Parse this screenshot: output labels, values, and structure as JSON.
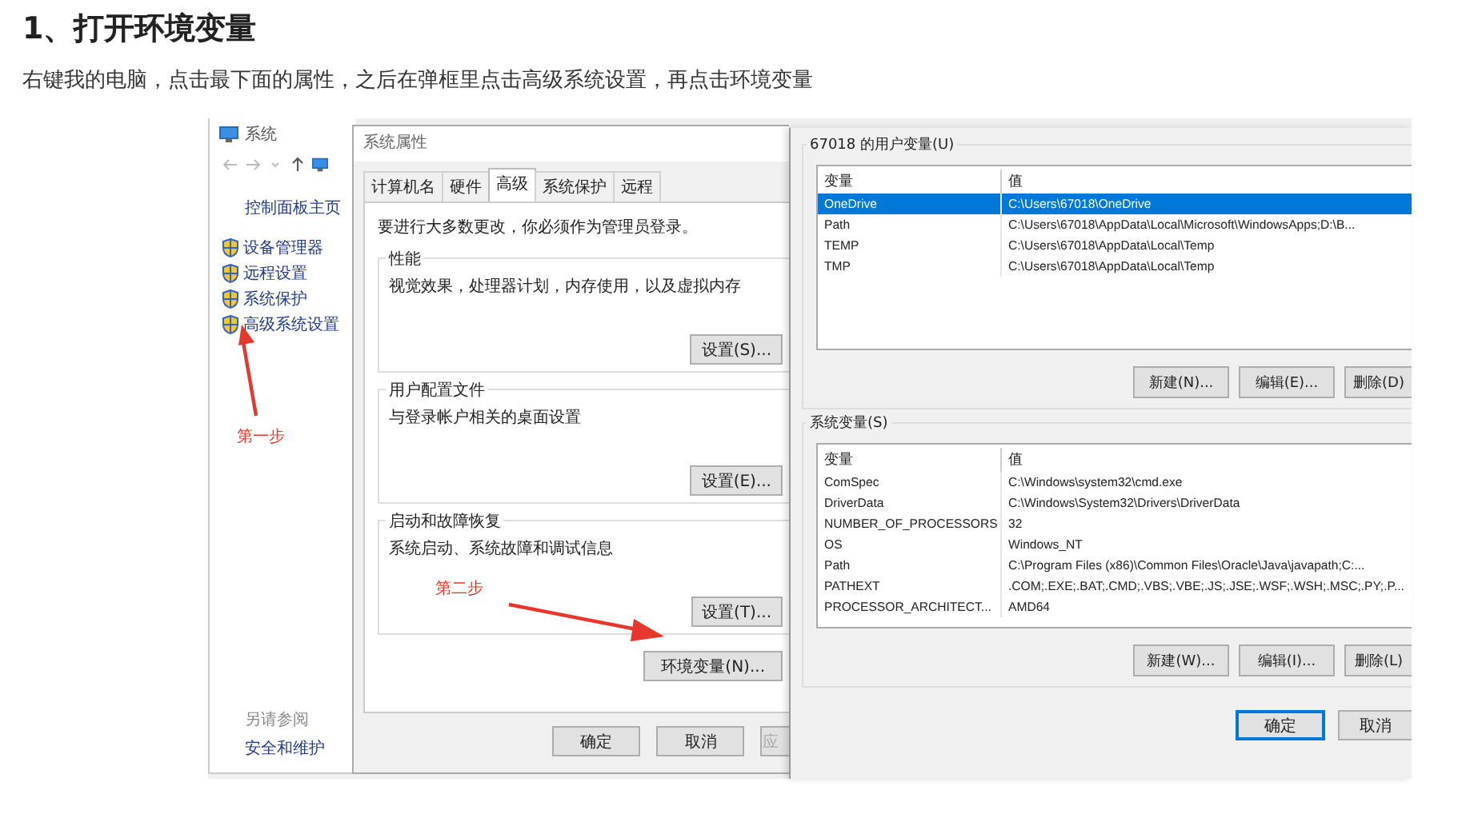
{
  "heading": "1、打开环境变量",
  "intro": "右键我的电脑，点击最下面的属性，之后在弹框里点击高级系统设置，再点击环境变量",
  "screenshot": {
    "system_window": {
      "title": "系统",
      "sidebar_links": [
        {
          "label": "控制面板主页",
          "kind": "plain"
        },
        {
          "label": "设备管理器",
          "kind": "shield"
        },
        {
          "label": "远程设置",
          "kind": "shield"
        },
        {
          "label": "系统保护",
          "kind": "shield"
        },
        {
          "label": "高级系统设置",
          "kind": "shield"
        }
      ],
      "see_also_title": "另请参阅",
      "see_also_links": [
        "安全和维护"
      ]
    },
    "properties_dialog": {
      "title": "系统属性",
      "tabs": [
        {
          "label": "计算机名",
          "selected": false
        },
        {
          "label": "硬件",
          "selected": false
        },
        {
          "label": "高级",
          "selected": true
        },
        {
          "label": "系统保护",
          "selected": false
        },
        {
          "label": "远程",
          "selected": false
        }
      ],
      "notice": "要进行大多数更改，你必须作为管理员登录。",
      "groups": [
        {
          "title": "性能",
          "description": "视觉效果，处理器计划，内存使用，以及虚拟内存",
          "button": "设置(S)..."
        },
        {
          "title": "用户配置文件",
          "description": "与登录帐户相关的桌面设置",
          "button": "设置(E)..."
        },
        {
          "title": "启动和故障恢复",
          "description": "系统启动、系统故障和调试信息",
          "button": "设置(T)..."
        }
      ],
      "env_button": "环境变量(N)...",
      "buttons": [
        {
          "label": "确定",
          "default": false
        },
        {
          "label": "取消",
          "default": false
        },
        {
          "label": "应",
          "default": false
        }
      ]
    },
    "env_dialog": {
      "sections": [
        {
          "title": "67018 的用户变量(U)",
          "columns": [
            "变量",
            "值"
          ],
          "rows": [
            {
              "name": "OneDrive",
              "value": "C:\\Users\\67018\\OneDrive",
              "selected": true
            },
            {
              "name": "Path",
              "value": "C:\\Users\\67018\\AppData\\Local\\Microsoft\\WindowsApps;D:\\B...",
              "selected": false
            },
            {
              "name": "TEMP",
              "value": "C:\\Users\\67018\\AppData\\Local\\Temp",
              "selected": false
            },
            {
              "name": "TMP",
              "value": "C:\\Users\\67018\\AppData\\Local\\Temp",
              "selected": false
            }
          ],
          "buttons": [
            "新建(N)...",
            "编辑(E)...",
            "删除(D)"
          ]
        },
        {
          "title": "系统变量(S)",
          "columns": [
            "变量",
            "值"
          ],
          "rows": [
            {
              "name": "ComSpec",
              "value": "C:\\Windows\\system32\\cmd.exe",
              "selected": false
            },
            {
              "name": "DriverData",
              "value": "C:\\Windows\\System32\\Drivers\\DriverData",
              "selected": false
            },
            {
              "name": "NUMBER_OF_PROCESSORS",
              "value": "32",
              "selected": false
            },
            {
              "name": "OS",
              "value": "Windows_NT",
              "selected": false
            },
            {
              "name": "Path",
              "value": "C:\\Program Files (x86)\\Common Files\\Oracle\\Java\\javapath;C:...",
              "selected": false
            },
            {
              "name": "PATHEXT",
              "value": ".COM;.EXE;.BAT;.CMD;.VBS;.VBE;.JS;.JSE;.WSF;.WSH;.MSC;.PY;.P...",
              "selected": false
            },
            {
              "name": "PROCESSOR_ARCHITECT...",
              "value": "AMD64",
              "selected": false
            }
          ],
          "buttons": [
            "新建(W)...",
            "编辑(I)...",
            "删除(L)"
          ]
        }
      ],
      "buttons": [
        {
          "label": "确定",
          "default": true
        },
        {
          "label": "取消",
          "default": false
        }
      ]
    },
    "annotations": [
      {
        "label": "第一步"
      },
      {
        "label": "第二步"
      }
    ]
  }
}
